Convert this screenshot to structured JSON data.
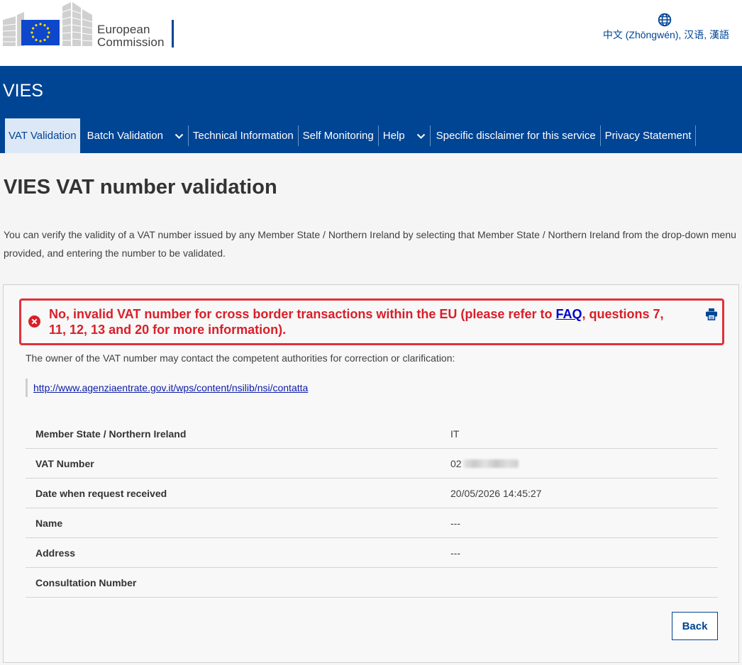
{
  "header": {
    "logo_text_line1": "European",
    "logo_text_line2": "Commission",
    "language_label": "中文 (Zhōngwén), 汉语, 漢語"
  },
  "site": {
    "name": "VIES"
  },
  "nav": {
    "items": [
      {
        "label": "VAT Validation",
        "active": true,
        "dropdown": false
      },
      {
        "label": "Batch Validation",
        "active": false,
        "dropdown": true
      },
      {
        "label": "Technical Information",
        "active": false,
        "dropdown": false
      },
      {
        "label": "Self Monitoring",
        "active": false,
        "dropdown": false
      },
      {
        "label": "Help",
        "active": false,
        "dropdown": true
      },
      {
        "label": "Specific disclaimer for this service",
        "active": false,
        "dropdown": false
      },
      {
        "label": "Privacy Statement",
        "active": false,
        "dropdown": false
      }
    ]
  },
  "main": {
    "title": "VIES VAT number validation",
    "intro": "You can verify the validity of a VAT number issued by any Member State / Northern Ireland by selecting that Member State / Northern Ireland from the drop-down menu provided, and entering the number to be validated."
  },
  "result": {
    "alert_text_before": "No, invalid VAT number for cross border transactions within the EU (please refer to ",
    "alert_link": "FAQ",
    "alert_text_after": ", questions 7, 11, 12, 13 and 20 for more information).",
    "owner_note": "The owner of the VAT number may contact the competent authorities for correction or clarification:",
    "contact_url": "http://www.agenziaentrate.gov.it/wps/content/nsilib/nsi/contatta",
    "details": [
      {
        "label": "Member State / Northern Ireland",
        "value": "IT"
      },
      {
        "label": "VAT Number",
        "value": "02"
      },
      {
        "label": "Date when request received",
        "value": "20/05/2026 14:45:27"
      },
      {
        "label": "Name",
        "value": "---"
      },
      {
        "label": "Address",
        "value": "---"
      },
      {
        "label": "Consultation Number",
        "value": ""
      }
    ],
    "back_label": "Back"
  },
  "colors": {
    "brand_blue": "#004494",
    "error_red": "#da1e28",
    "eu_flag_blue": "#0e47cb",
    "eu_star_yellow": "#ffdd00"
  },
  "icons": [
    "globe-icon",
    "chevron-down-icon",
    "error-circle-icon",
    "print-icon"
  ]
}
